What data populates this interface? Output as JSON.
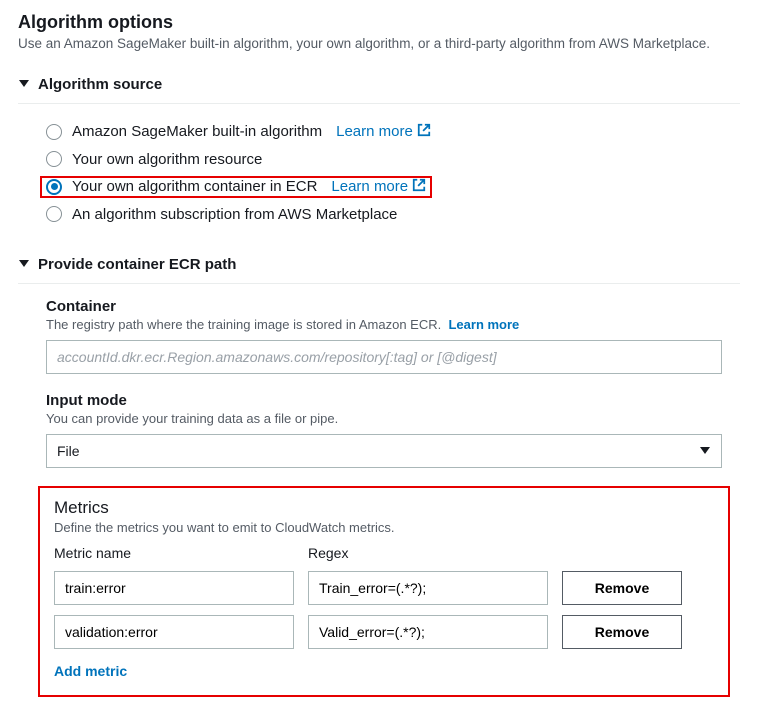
{
  "page": {
    "title": "Algorithm options",
    "subtitle": "Use an Amazon SageMaker built-in algorithm, your own algorithm, or a third-party algorithm from AWS Marketplace."
  },
  "source": {
    "header": "Algorithm source",
    "options": [
      {
        "label": "Amazon SageMaker built-in algorithm",
        "learn_more": true,
        "selected": false
      },
      {
        "label": "Your own algorithm resource",
        "learn_more": false,
        "selected": false
      },
      {
        "label": "Your own algorithm container in ECR",
        "learn_more": true,
        "selected": true
      },
      {
        "label": "An algorithm subscription from AWS Marketplace",
        "learn_more": false,
        "selected": false
      }
    ],
    "learn_more_text": "Learn more"
  },
  "ecr": {
    "header": "Provide container ECR path",
    "container_label": "Container",
    "container_desc": "The registry path where the training image is stored in Amazon ECR.",
    "container_learn": "Learn more",
    "container_placeholder": "accountId.dkr.ecr.Region.amazonaws.com/repository[:tag] or [@digest]",
    "input_mode_label": "Input mode",
    "input_mode_desc": "You can provide your training data as a file or pipe.",
    "input_mode_value": "File"
  },
  "metrics": {
    "title": "Metrics",
    "desc": "Define the metrics you want to emit to CloudWatch metrics.",
    "col_name": "Metric name",
    "col_regex": "Regex",
    "remove_label": "Remove",
    "add_label": "Add metric",
    "rows": [
      {
        "name": "train:error",
        "regex": "Train_error=(.*?);"
      },
      {
        "name": "validation:error",
        "regex": "Valid_error=(.*?);"
      }
    ]
  }
}
